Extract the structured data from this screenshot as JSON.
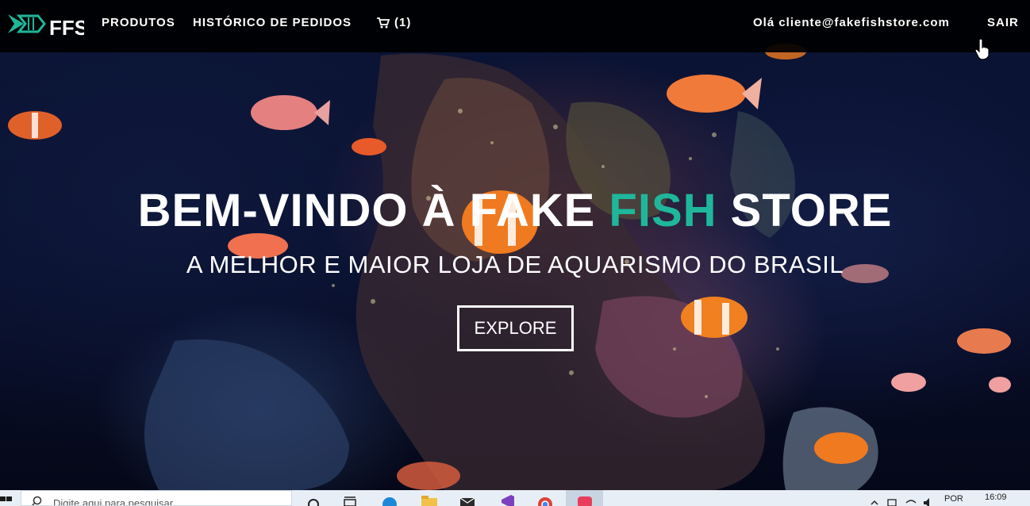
{
  "navbar": {
    "logo_text": "FFS",
    "links": {
      "products": "PRODUTOS",
      "orders": "HISTÓRICO DE PEDIDOS",
      "cart_count": "(1)",
      "greeting": "Olá cliente@fakefishstore.com",
      "logout": "SAIR"
    }
  },
  "hero": {
    "title_part1": "BEM-VINDO À FAKE ",
    "title_accent": "FISH",
    "title_part2": " STORE",
    "subtitle": "A MELHOR E MAIOR LOJA DE AQUARISMO DO BRASIL",
    "button": "EXPLORE"
  },
  "taskbar": {
    "search_placeholder": "Digite aqui para pesquisar",
    "language": "POR",
    "time": "16:09"
  },
  "icons": {
    "cart": "shopping-cart-icon",
    "cursor": "hand-pointer-icon",
    "start": "windows-start-icon",
    "search": "search-icon",
    "taskview": "task-view-icon",
    "edge": "edge-browser-icon",
    "explorer": "file-explorer-icon",
    "mail": "mail-icon",
    "vs": "visual-studio-icon",
    "chrome": "chrome-icon",
    "app": "app-icon"
  },
  "colors": {
    "accent": "#1fb79b",
    "navbar_bg": "#000000"
  }
}
